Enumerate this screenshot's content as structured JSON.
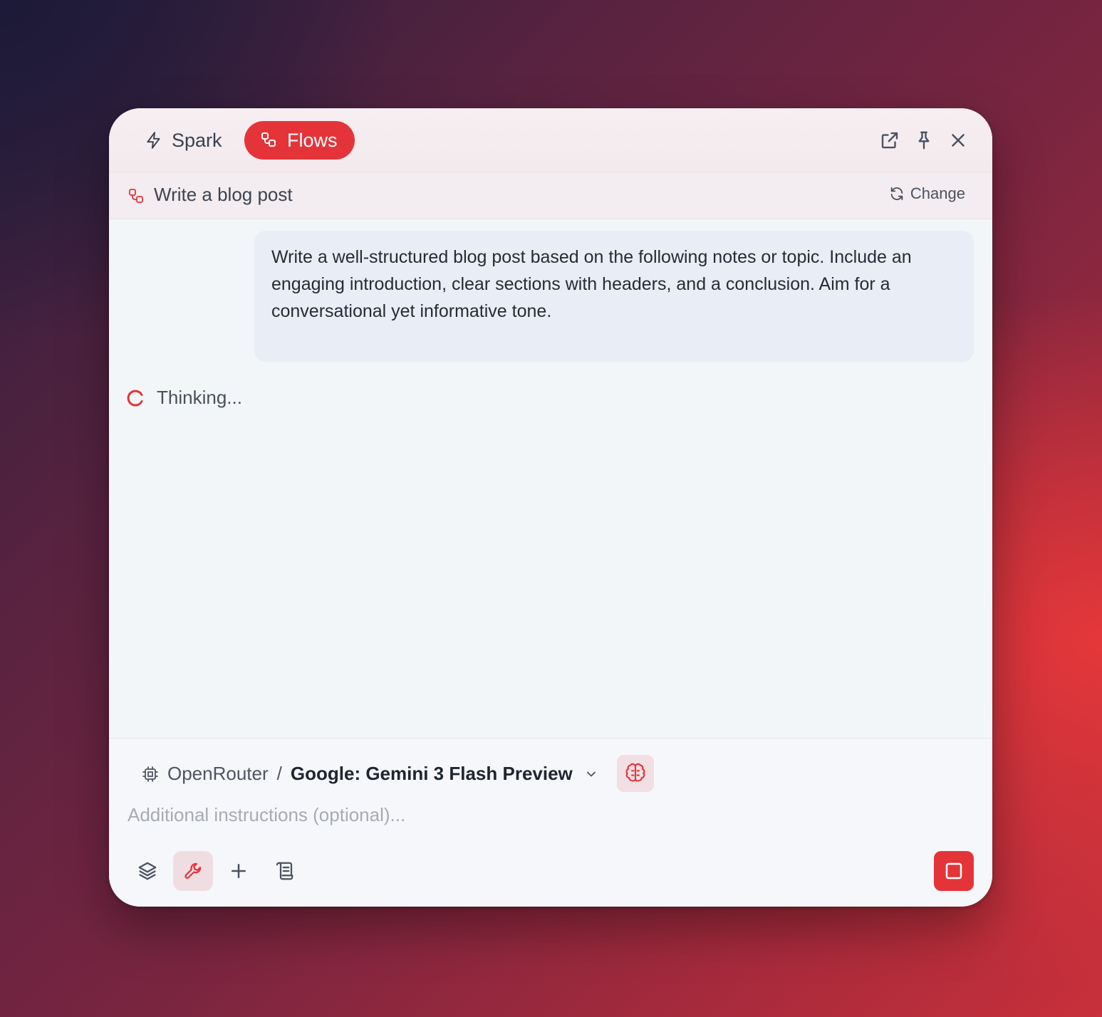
{
  "header": {
    "tabs": [
      {
        "label": "Spark",
        "icon": "lightning-icon",
        "active": false
      },
      {
        "label": "Flows",
        "icon": "flows-icon",
        "active": true
      }
    ],
    "window_controls": [
      "external-link-icon",
      "pin-icon",
      "close-icon"
    ]
  },
  "flow": {
    "title": "Write a blog post",
    "change_label": "Change"
  },
  "conversation": {
    "user_message": "Write a well-structured blog post based on the following notes or topic. Include an engaging introduction, clear sections with headers, and a conclusion. Aim for a conversational yet informative tone.",
    "status": "Thinking..."
  },
  "composer": {
    "provider": "OpenRouter",
    "separator": "/",
    "model": "Google: Gemini 3 Flash Preview",
    "placeholder": "Additional instructions (optional)...",
    "tools": [
      "layers-icon",
      "wrench-icon",
      "plus-icon",
      "scroll-icon"
    ],
    "stop_icon": "stop-icon"
  },
  "colors": {
    "accent": "#e4343a",
    "accent_soft": "#f0dde2",
    "text_primary": "#252b38",
    "placeholder": "#a7abb2"
  }
}
